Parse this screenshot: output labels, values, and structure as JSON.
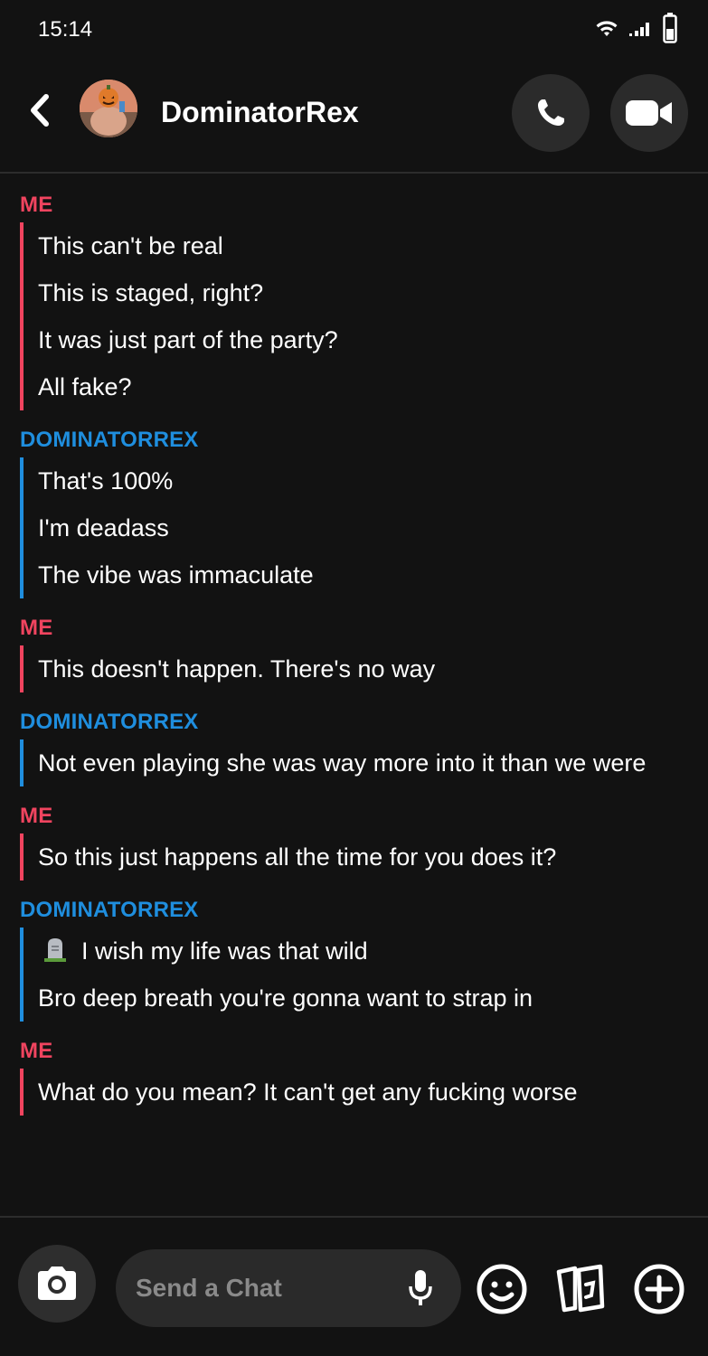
{
  "status": {
    "time": "15:14"
  },
  "header": {
    "contact_name": "DominatorRex"
  },
  "conversation": [
    {
      "sender": "ME",
      "side": "me",
      "messages": [
        "This can't be real",
        "This is staged, right?",
        "It was just part of the party?",
        "All fake?"
      ]
    },
    {
      "sender": "DOMINATORREX",
      "side": "them",
      "messages": [
        "That's 100%",
        "I'm deadass",
        "The vibe was immaculate"
      ]
    },
    {
      "sender": "ME",
      "side": "me",
      "messages": [
        "This doesn't happen. There's no way"
      ]
    },
    {
      "sender": "DOMINATORREX",
      "side": "them",
      "messages": [
        "Not even playing she was way more into it than we were"
      ]
    },
    {
      "sender": "ME",
      "side": "me",
      "messages": [
        "So this just happens all the time for you does it?"
      ]
    },
    {
      "sender": "DOMINATORREX",
      "side": "them",
      "messages": [
        "I wish my life was that wild",
        "Bro deep breath you're gonna want to strap in"
      ]
    },
    {
      "sender": "ME",
      "side": "me",
      "messages": [
        "What do you mean? It can't get any fucking worse"
      ]
    }
  ],
  "composer": {
    "placeholder": "Send a Chat"
  },
  "colors": {
    "me": "#f0445f",
    "them": "#1f8ede",
    "background": "#121212"
  },
  "icons": [
    "wifi-icon",
    "signal-icon",
    "battery-icon",
    "back-icon",
    "phone-icon",
    "video-icon",
    "camera-icon",
    "mic-icon",
    "emoji-icon",
    "cards-icon",
    "plus-icon",
    "headstone-emoji-icon"
  ]
}
